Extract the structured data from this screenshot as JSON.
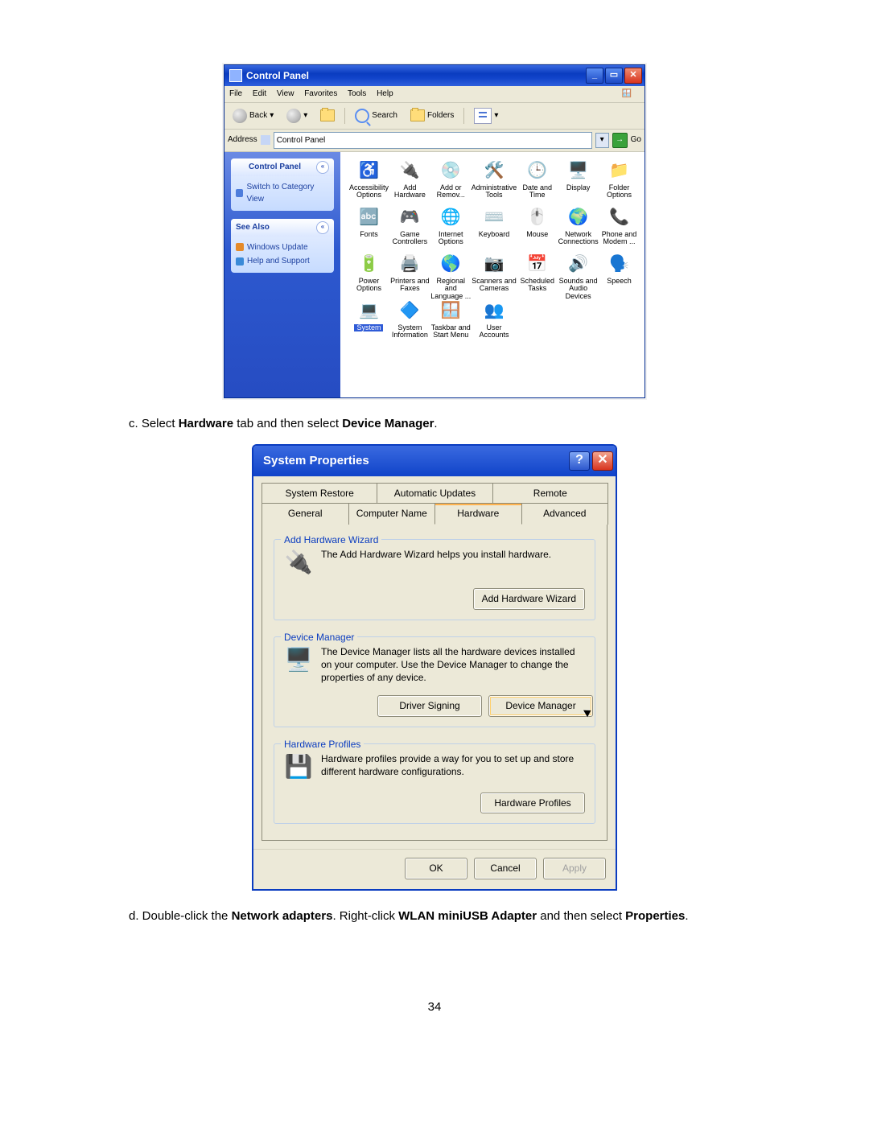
{
  "page_number": "34",
  "step_c": {
    "prefix": "c.  Select ",
    "b1": "Hardware",
    "mid": " tab and then select ",
    "b2": "Device Manager",
    "suffix": "."
  },
  "step_d": {
    "prefix": "d.  Double-click the ",
    "b1": "Network adapters",
    "mid1": ". Right-click ",
    "b2": "WLAN miniUSB Adapter",
    "mid2": " and then select ",
    "b3": "Properties",
    "suffix": "."
  },
  "cp": {
    "title": "Control Panel",
    "menus": [
      "File",
      "Edit",
      "View",
      "Favorites",
      "Tools",
      "Help"
    ],
    "toolbar": {
      "back": "Back",
      "search": "Search",
      "folders": "Folders"
    },
    "address_label": "Address",
    "address_value": "Control Panel",
    "go": "Go",
    "side": {
      "box1_title": "Control Panel",
      "switch_link": "Switch to Category View",
      "box2_title": "See Also",
      "see_also": [
        "Windows Update",
        "Help and Support"
      ]
    },
    "icons": [
      {
        "label": "Accessibility Options",
        "glyph": "♿"
      },
      {
        "label": "Add Hardware",
        "glyph": "🔌"
      },
      {
        "label": "Add or Remov...",
        "glyph": "💿"
      },
      {
        "label": "Administrative Tools",
        "glyph": "🛠️"
      },
      {
        "label": "Date and Time",
        "glyph": "🕒"
      },
      {
        "label": "Display",
        "glyph": "🖥️"
      },
      {
        "label": "Folder Options",
        "glyph": "📁"
      },
      {
        "label": "Fonts",
        "glyph": "🔤"
      },
      {
        "label": "Game Controllers",
        "glyph": "🎮"
      },
      {
        "label": "Internet Options",
        "glyph": "🌐"
      },
      {
        "label": "Keyboard",
        "glyph": "⌨️"
      },
      {
        "label": "Mouse",
        "glyph": "🖱️"
      },
      {
        "label": "Network Connections",
        "glyph": "🌍"
      },
      {
        "label": "Phone and Modem ...",
        "glyph": "📞"
      },
      {
        "label": "Power Options",
        "glyph": "🔋"
      },
      {
        "label": "Printers and Faxes",
        "glyph": "🖨️"
      },
      {
        "label": "Regional and Language ...",
        "glyph": "🌎"
      },
      {
        "label": "Scanners and Cameras",
        "glyph": "📷"
      },
      {
        "label": "Scheduled Tasks",
        "glyph": "📅"
      },
      {
        "label": "Sounds and Audio Devices",
        "glyph": "🔊"
      },
      {
        "label": "Speech",
        "glyph": "🗣️"
      },
      {
        "label": "System",
        "glyph": "💻",
        "selected": true
      },
      {
        "label": "System Information",
        "glyph": "🔷"
      },
      {
        "label": "Taskbar and Start Menu",
        "glyph": "🪟"
      },
      {
        "label": "User Accounts",
        "glyph": "👥"
      }
    ]
  },
  "sp": {
    "title": "System Properties",
    "tabs_back": [
      "System Restore",
      "Automatic Updates",
      "Remote"
    ],
    "tabs_front": [
      "General",
      "Computer Name",
      "Hardware",
      "Advanced"
    ],
    "active_tab": "Hardware",
    "groups": {
      "add_hw": {
        "legend": "Add Hardware Wizard",
        "text": "The Add Hardware Wizard helps you install hardware.",
        "btn": "Add Hardware Wizard"
      },
      "dev_mgr": {
        "legend": "Device Manager",
        "text": "The Device Manager lists all the hardware devices installed on your computer. Use the Device Manager to change the properties of any device.",
        "btn1": "Driver Signing",
        "btn2": "Device Manager"
      },
      "hw_prof": {
        "legend": "Hardware Profiles",
        "text": "Hardware profiles provide a way for you to set up and store different hardware configurations.",
        "btn": "Hardware Profiles"
      }
    },
    "footer": {
      "ok": "OK",
      "cancel": "Cancel",
      "apply": "Apply"
    }
  }
}
